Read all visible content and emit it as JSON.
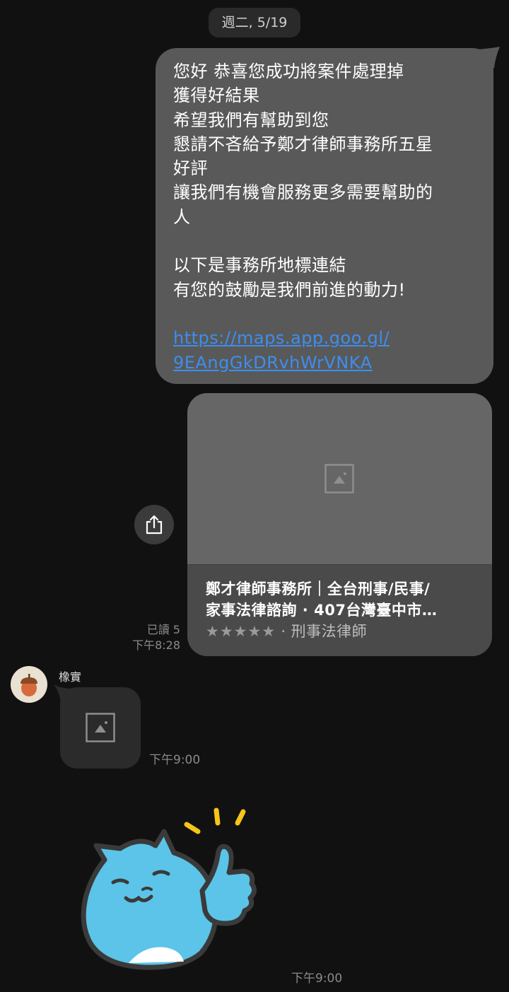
{
  "date_header": "週二, 5/19",
  "outgoing_message": {
    "lines": [
      "您好 恭喜您成功將案件處理掉",
      "獲得好結果",
      "希望我們有幫助到您",
      "懇請不吝給予鄭才律師事務所五星",
      "好評",
      "讓我們有機會服務更多需要幫助的",
      "人",
      "",
      "以下是事務所地標連結",
      "有您的鼓勵是我們前進的動力!",
      ""
    ],
    "link_line1": "https://maps.app.goo.gl/",
    "link_line2": "9EAngGkDRvhWrVNKA"
  },
  "link_preview": {
    "title_line1": "鄭才律師事務所｜全台刑事/民事/",
    "title_line2": "家事法律諮詢 · 407台灣臺中市…",
    "stars": "★★★★★",
    "category": " · 刑事法律師",
    "image_icon": "image-placeholder-icon"
  },
  "read_status": {
    "read": "已讀 5",
    "time": "下午8:28"
  },
  "incoming": {
    "sender_name": "橡實",
    "avatar_icon": "acorn-icon",
    "image_time": "下午9:00",
    "sticker_time": "下午9:00"
  },
  "colors": {
    "background": "#111111",
    "outgoing_bubble": "#595959",
    "link": "#3d8ef0",
    "incoming_bubble": "#2b2b2b",
    "sticker_blue": "#5bc4e8"
  }
}
